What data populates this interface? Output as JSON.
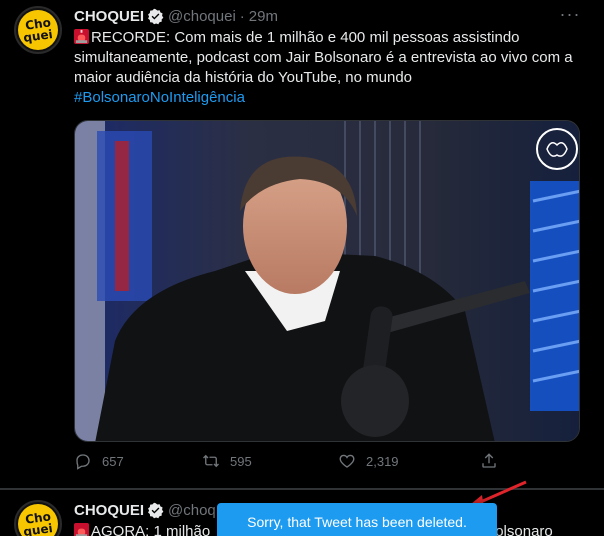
{
  "tweets": [
    {
      "avatar_line1": "Cho",
      "avatar_line2": "quei",
      "name": "CHOQUEI",
      "handle": "@choquei",
      "separator": "·",
      "time": "29m",
      "text": "RECORDE: Com mais de 1 milhão e 400 mil pessoas assistindo simultaneamente, podcast com Jair Bolsonaro é a entrevista ao vivo com a maior audiência da história do YouTube, no mundo",
      "hashtag": "#BolsonaroNoInteligência",
      "stats": {
        "replies": "657",
        "retweets": "595",
        "likes": "2,319"
      }
    },
    {
      "avatar_line1": "Cho",
      "avatar_line2": "quei",
      "name": "CHOQUEI",
      "handle": "@choq",
      "text_start": "AGORA: 1 milhão",
      "text_end": "olsonaro"
    }
  ],
  "toast": {
    "message": "Sorry, that Tweet has been deleted."
  },
  "icons": {
    "more": "more-horizontal-icon",
    "verified": "verified-badge-icon",
    "siren": "rotating-light-emoji",
    "reply": "reply-icon",
    "retweet": "retweet-icon",
    "like": "heart-icon",
    "share": "share-icon",
    "watermark": "brain-logo-icon"
  },
  "colors": {
    "background": "#000000",
    "accent": "#1d9bf0",
    "muted": "#71767b",
    "text": "#e7e9ea",
    "arrow": "#e0242b"
  }
}
